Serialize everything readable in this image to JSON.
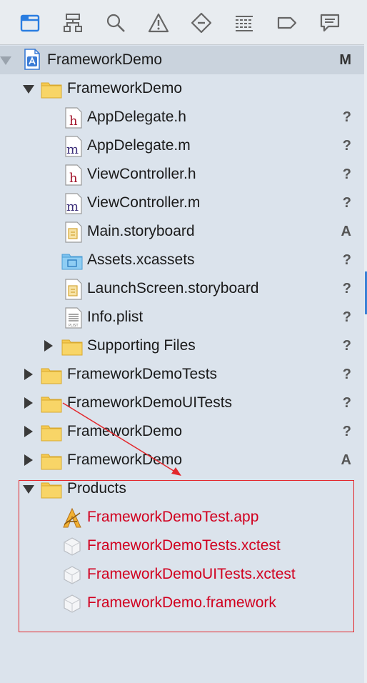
{
  "toolbar": {
    "icons": [
      "folder-icon",
      "hierarchy-icon",
      "search-icon",
      "warning-icon",
      "diamond-icon",
      "list-icon",
      "tag-icon",
      "message-icon"
    ]
  },
  "project": {
    "name": "FrameworkDemo",
    "status": "M"
  },
  "group_app": {
    "name": "FrameworkDemo"
  },
  "files": [
    {
      "name": "AppDelegate.h",
      "status": "?"
    },
    {
      "name": "AppDelegate.m",
      "status": "?"
    },
    {
      "name": "ViewController.h",
      "status": "?"
    },
    {
      "name": "ViewController.m",
      "status": "?"
    },
    {
      "name": "Main.storyboard",
      "status": "A"
    },
    {
      "name": "Assets.xcassets",
      "status": "?"
    },
    {
      "name": "LaunchScreen.storyboard",
      "status": "?"
    },
    {
      "name": "Info.plist",
      "status": "?"
    }
  ],
  "supporting": {
    "name": "Supporting Files",
    "status": "?"
  },
  "groups": [
    {
      "name": "FrameworkDemoTests",
      "status": "?"
    },
    {
      "name": "FrameworkDemoUITests",
      "status": "?"
    },
    {
      "name": "FrameworkDemo",
      "status": "?"
    },
    {
      "name": "FrameworkDemo",
      "status": "A"
    }
  ],
  "products": {
    "name": "Products",
    "items": [
      {
        "name": "FrameworkDemoTest.app"
      },
      {
        "name": "FrameworkDemoTests.xctest"
      },
      {
        "name": "FrameworkDemoUITests.xctest"
      },
      {
        "name": "FrameworkDemo.framework"
      }
    ]
  },
  "colors": {
    "highlight": "#d1001f",
    "annotation": "#e3282d",
    "folder": "#f5c950"
  }
}
